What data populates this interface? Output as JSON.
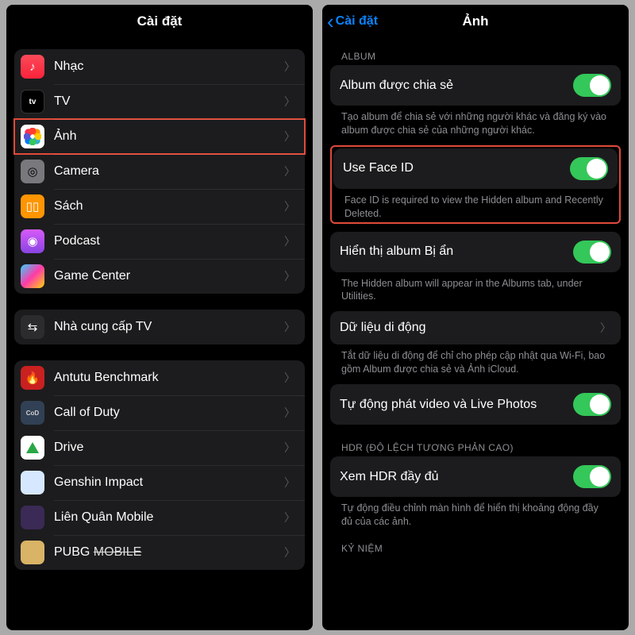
{
  "left": {
    "title": "Cài đặt",
    "group1": [
      {
        "name": "music",
        "label": "Nhạc",
        "iconClass": "ic-music",
        "glyph": "♪",
        "highlighted": false
      },
      {
        "name": "tv",
        "label": "TV",
        "iconClass": "ic-tv",
        "glyph": "tv",
        "highlighted": false
      },
      {
        "name": "photos",
        "label": "Ảnh",
        "iconClass": "ic-photos",
        "glyph": "",
        "highlighted": true
      },
      {
        "name": "camera",
        "label": "Camera",
        "iconClass": "ic-camera",
        "glyph": "◎",
        "highlighted": false
      },
      {
        "name": "books",
        "label": "Sách",
        "iconClass": "ic-books",
        "glyph": "▯▯",
        "highlighted": false
      },
      {
        "name": "podcast",
        "label": "Podcast",
        "iconClass": "ic-podcast",
        "glyph": "◉",
        "highlighted": false
      },
      {
        "name": "gc",
        "label": "Game Center",
        "iconClass": "ic-gc",
        "glyph": "",
        "highlighted": false
      }
    ],
    "group2": [
      {
        "name": "tvprovider",
        "label": "Nhà cung cấp TV",
        "iconClass": "ic-tvprov",
        "glyph": "⇆"
      }
    ],
    "group3": [
      {
        "name": "antutu",
        "label": "Antutu Benchmark",
        "iconClass": "ic-antutu",
        "glyph": "🔥"
      },
      {
        "name": "cod",
        "label": "Call of Duty",
        "iconClass": "ic-cod",
        "glyph": "CoD"
      },
      {
        "name": "drive",
        "label": "Drive",
        "iconClass": "ic-drive",
        "glyph": ""
      },
      {
        "name": "genshin",
        "label": "Genshin Impact",
        "iconClass": "ic-genshin",
        "glyph": ""
      },
      {
        "name": "lq",
        "label": "Liên Quân Mobile",
        "iconClass": "ic-lq",
        "glyph": ""
      },
      {
        "name": "pubg",
        "label": "PUBG MOBILE",
        "iconClass": "ic-pubg",
        "glyph": "",
        "strike": true
      }
    ]
  },
  "right": {
    "back": "Cài đặt",
    "title": "Ảnh",
    "album_header": "ALBUM",
    "shared_album": {
      "label": "Album được chia sẻ",
      "desc": "Tạo album để chia sẻ với những người khác và đăng ký vào album được chia sẻ của những người khác."
    },
    "faceid": {
      "label": "Use Face ID",
      "desc": "Face ID is required to view the Hidden album and Recently Deleted."
    },
    "hidden": {
      "label": "Hiển thị album Bị ẩn",
      "desc": "The Hidden album will appear in the Albums tab, under Utilities."
    },
    "cellular": {
      "label": "Dữ liệu di động",
      "desc": "Tắt dữ liệu di động để chỉ cho phép cập nhật qua Wi-Fi, bao gồm Album được chia sẻ và Ảnh iCloud."
    },
    "autoplay": {
      "label": "Tự động phát video và Live Photos"
    },
    "hdr_header": "HDR (ĐỘ LỆCH TƯƠNG PHẢN CAO)",
    "hdr": {
      "label": "Xem HDR đầy đủ",
      "desc": "Tự động điều chỉnh màn hình để hiển thị khoảng động đầy đủ của các ảnh."
    },
    "memories_header": "KỶ NIỆM"
  }
}
